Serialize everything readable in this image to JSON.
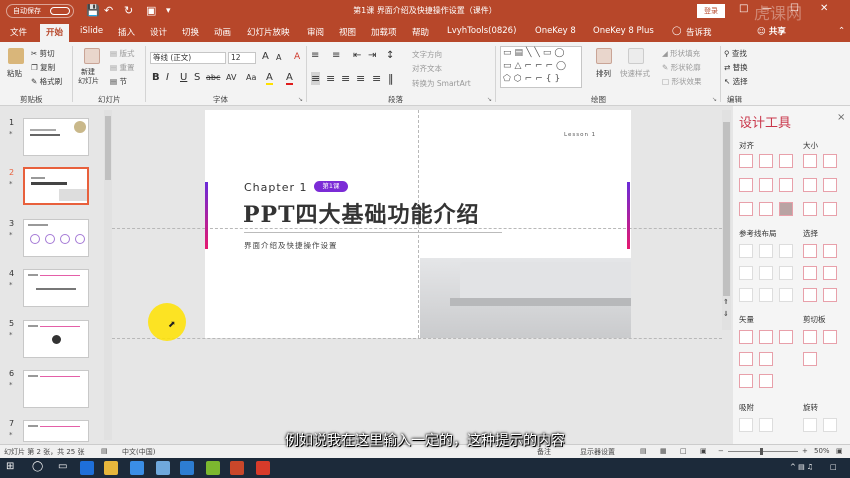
{
  "app": {
    "autosave": "自动保存",
    "title": "第1课 界面介绍及快捷操作设置（课件）",
    "login": "登录",
    "watermark": "虎课网"
  },
  "quick_access": {
    "save": "save-icon",
    "undo": "undo-icon",
    "redo": "redo-icon",
    "present": "present-icon"
  },
  "tabs": [
    "文件",
    "开始",
    "iSlide",
    "插入",
    "设计",
    "切换",
    "动画",
    "幻灯片放映",
    "审阅",
    "视图",
    "加载项",
    "帮助",
    "LvyhTools(0826)",
    "OneKey 8",
    "OneKey 8 Plus"
  ],
  "active_tab": "开始",
  "tell_me": "告诉我",
  "share": "共享",
  "ribbon": {
    "clipboard": {
      "label": "剪贴板",
      "paste": "粘贴",
      "cut": "剪切",
      "copy": "复制",
      "format_painter": "格式刷"
    },
    "slides": {
      "label": "幻灯片",
      "new_slide": "新建\n幻灯片",
      "layout": "版式",
      "reset": "重置",
      "section": "节"
    },
    "font": {
      "label": "字体",
      "font_name": "等线 (正文)",
      "font_size": "12",
      "bold": "B",
      "italic": "I",
      "underline": "U",
      "strike": "S",
      "shadow": "abc",
      "spacing": "AV",
      "case": "Aa",
      "grow": "A",
      "shrink": "A",
      "clear": "A",
      "highlight": "A",
      "color": "A"
    },
    "paragraph": {
      "label": "段落",
      "text_direction": "文字方向",
      "align_text": "对齐文本",
      "smartart": "转换为 SmartArt"
    },
    "drawing": {
      "label": "绘图",
      "arrange": "排列",
      "quick_styles": "快速样式",
      "fill": "形状填充",
      "outline": "形状轮廓",
      "effects": "形状效果"
    },
    "editing": {
      "label": "编辑",
      "find": "查找",
      "replace": "替换",
      "select": "选择"
    }
  },
  "thumbnails": [
    {
      "num": "1",
      "star": "*"
    },
    {
      "num": "2",
      "star": "*"
    },
    {
      "num": "3",
      "star": "*"
    },
    {
      "num": "4",
      "star": "*"
    },
    {
      "num": "5",
      "star": "*"
    },
    {
      "num": "6",
      "star": "*"
    },
    {
      "num": "7",
      "star": "*"
    }
  ],
  "slide": {
    "lesson": "Lesson 1",
    "chapter": "Chapter 1",
    "badge": "第1课",
    "title": "PPT四大基础功能介绍",
    "subtitle": "界面介绍及快捷操作设置"
  },
  "design_tools": {
    "title": "设计工具",
    "close": "×",
    "sections": [
      "对齐",
      "大小",
      "参考线布局",
      "选择",
      "矢量",
      "剪切板",
      "吸附",
      "旋转"
    ]
  },
  "status": {
    "slide_info": "幻灯片 第 2 张，共 25 张",
    "language": "中文(中国)",
    "notes": "备注",
    "display": "显示器设置",
    "zoom": "50%"
  },
  "caption": "例如说我在这里输入一定的，这种提示的内容",
  "colors": {
    "accent": "#b7472a",
    "brand_tool": "#c9364a",
    "badge": "#7b2bd6",
    "highlight": "#ffe200"
  }
}
